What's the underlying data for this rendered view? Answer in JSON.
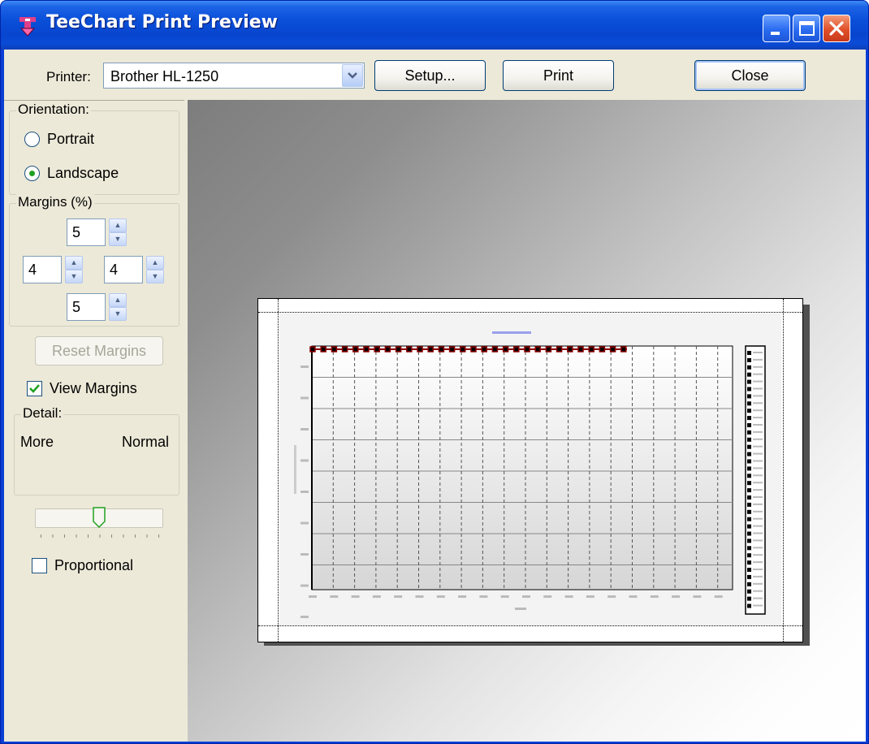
{
  "window": {
    "title": "TeeChart Print Preview"
  },
  "toolbar": {
    "printer_label": "Printer:",
    "printer_value": "Brother HL-1250",
    "setup_label": "Setup...",
    "print_label": "Print",
    "close_label": "Close"
  },
  "orientation": {
    "legend": "Orientation:",
    "portrait_label": "Portrait",
    "landscape_label": "Landscape",
    "selected": "Landscape"
  },
  "margins": {
    "legend": "Margins (%)",
    "top": "5",
    "left": "4",
    "right": "4",
    "bottom": "5",
    "reset_label": "Reset Margins",
    "view_margins_label": "View Margins",
    "view_margins_checked": true
  },
  "detail": {
    "legend": "Detail:",
    "more_label": "More",
    "normal_label": "Normal",
    "level": 0.5
  },
  "proportional": {
    "label": "Proportional",
    "checked": false
  },
  "colors": {
    "title_bar": "#0a4fd8",
    "dialog_face": "#ece9d8",
    "close_button": "#e0502a",
    "radio_dot": "#21a121",
    "series_marker": "#8b0000"
  },
  "icons": {
    "app": "teechart-app-icon",
    "minimize": "minimize-icon",
    "maximize": "maximize-icon",
    "close": "close-icon",
    "dropdown": "chevron-down-icon",
    "nav_first": "first-page-icon",
    "nav_prev": "previous-page-icon",
    "nav_next": "next-page-icon",
    "nav_last": "last-page-icon"
  }
}
